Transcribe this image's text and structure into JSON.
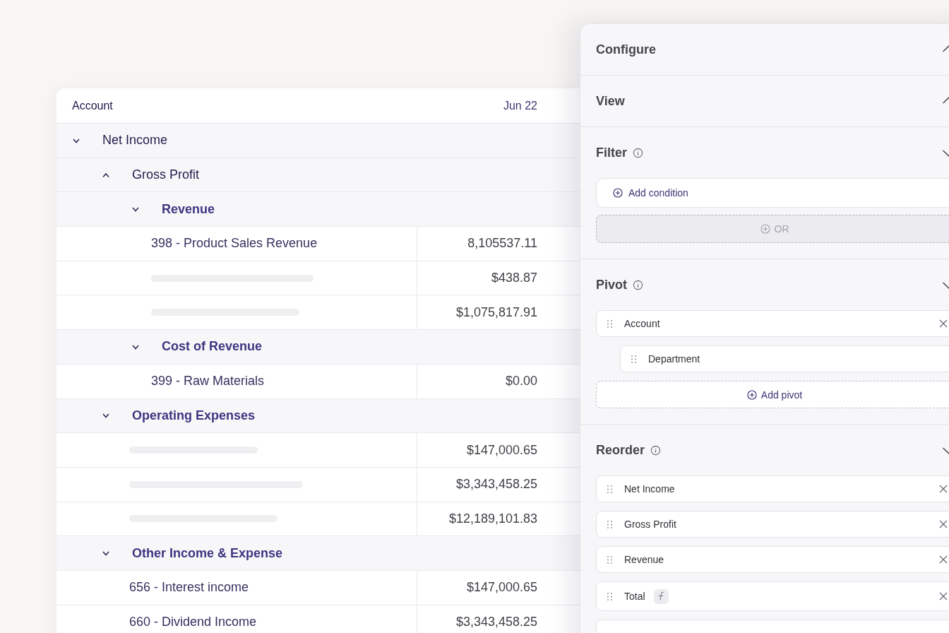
{
  "table": {
    "columns": [
      "Account",
      "Jun 22"
    ],
    "rows": [
      {
        "label": "Net Income",
        "caret_up": false,
        "children": [
          {
            "label": "Gross Profit",
            "caret_up": true,
            "children": [
              {
                "label": "Revenue",
                "caret_up": false,
                "children": [
                  {
                    "kind": "account",
                    "label": "398 - Product Sales Revenue",
                    "value": "8,105537.11"
                  },
                  {
                    "kind": "placeholder",
                    "value": "$438.87"
                  },
                  {
                    "kind": "placeholder",
                    "value": "$1,075,817.91"
                  }
                ]
              },
              {
                "label": "Cost of Revenue",
                "caret_up": false,
                "children": [
                  {
                    "kind": "account",
                    "label": "399 - Raw Materials",
                    "value": "$0.00"
                  }
                ]
              }
            ]
          },
          {
            "label": "Operating Expenses",
            "caret_up": false,
            "children": [
              {
                "kind": "placeholder",
                "value": "$147,000.65"
              },
              {
                "kind": "placeholder",
                "value": "$3,343,458.25"
              },
              {
                "kind": "placeholder",
                "value": "$12,189,101.83"
              }
            ]
          },
          {
            "label": "Other Income & Expense",
            "caret_up": false,
            "children": [
              {
                "kind": "account",
                "label": "656 - Interest income",
                "value": "$147,000.65"
              },
              {
                "kind": "account",
                "label": "660 - Dividend Income",
                "value": "$3,343,458.25"
              }
            ]
          }
        ]
      }
    ]
  },
  "panel": {
    "sections": [
      {
        "kind": "plain",
        "title": "Configure",
        "expanded": false
      },
      {
        "kind": "plain",
        "title": "View",
        "expanded": false
      },
      {
        "kind": "filter",
        "title": "Filter",
        "info": true,
        "expanded": true,
        "add_button": "Add condition",
        "or_button": {
          "label": "OR",
          "disabled": true
        }
      },
      {
        "kind": "pivot",
        "title": "Pivot",
        "info": true,
        "expanded": true,
        "items": [
          {
            "label": "Account",
            "children": [
              {
                "label": "Department"
              }
            ]
          }
        ],
        "add_button": "Add pivot"
      },
      {
        "kind": "reorder",
        "title": "Reorder",
        "info": true,
        "expanded": true,
        "items": [
          {
            "label": "Net Income",
            "formula": false
          },
          {
            "label": "Gross Profit",
            "formula": false
          },
          {
            "label": "Revenue",
            "formula": false
          },
          {
            "label": "Total",
            "formula": true
          }
        ],
        "more_below": true
      }
    ]
  }
}
